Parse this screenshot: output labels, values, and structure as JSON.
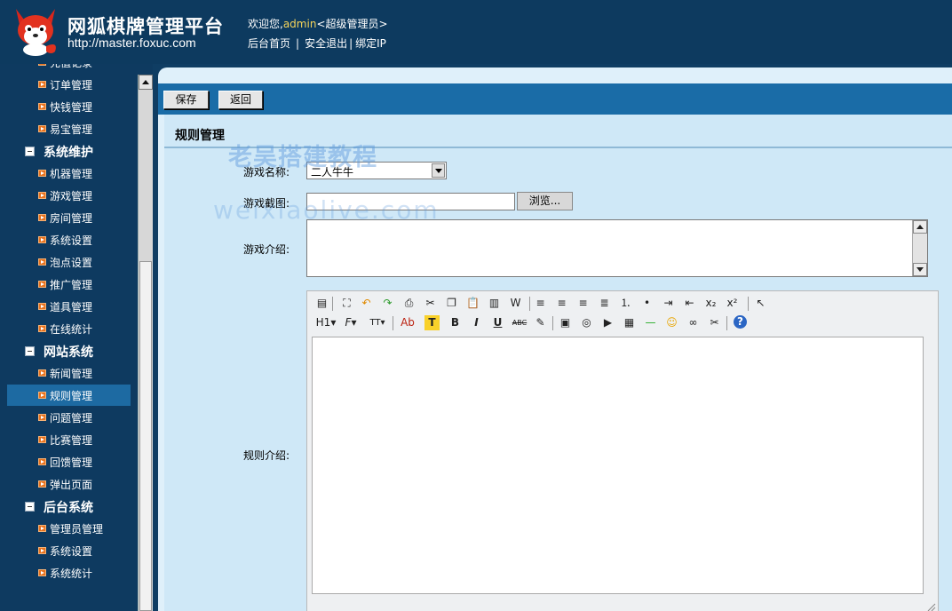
{
  "header": {
    "title": "网狐棋牌管理平台",
    "url": "http://master.foxuc.com",
    "welcome_prefix": "欢迎您,",
    "username": "admin",
    "role": "<超级管理员>",
    "links": [
      "后台首页",
      "安全退出",
      "绑定IP"
    ]
  },
  "sidebar": {
    "items": [
      {
        "type": "item",
        "label": "充值记录"
      },
      {
        "type": "item",
        "label": "订单管理"
      },
      {
        "type": "item",
        "label": "快钱管理"
      },
      {
        "type": "item",
        "label": "易宝管理"
      },
      {
        "type": "group",
        "label": "系统维护"
      },
      {
        "type": "item",
        "label": "机器管理"
      },
      {
        "type": "item",
        "label": "游戏管理"
      },
      {
        "type": "item",
        "label": "房间管理"
      },
      {
        "type": "item",
        "label": "系统设置"
      },
      {
        "type": "item",
        "label": "泡点设置"
      },
      {
        "type": "item",
        "label": "推广管理"
      },
      {
        "type": "item",
        "label": "道具管理"
      },
      {
        "type": "item",
        "label": "在线统计"
      },
      {
        "type": "group",
        "label": "网站系统"
      },
      {
        "type": "item",
        "label": "新闻管理"
      },
      {
        "type": "item",
        "label": "规则管理",
        "active": true
      },
      {
        "type": "item",
        "label": "问题管理"
      },
      {
        "type": "item",
        "label": "比赛管理"
      },
      {
        "type": "item",
        "label": "回馈管理"
      },
      {
        "type": "item",
        "label": "弹出页面"
      },
      {
        "type": "group",
        "label": "后台系统"
      },
      {
        "type": "item",
        "label": "管理员管理"
      },
      {
        "type": "item",
        "label": "系统设置"
      },
      {
        "type": "item",
        "label": "系统统计"
      }
    ]
  },
  "toolbar": {
    "save_label": "保存",
    "back_label": "返回"
  },
  "form": {
    "section_title": "规则管理",
    "game_name_label": "游戏名称:",
    "game_name_value": "二人牛牛",
    "screenshot_label": "游戏截图:",
    "browse_label": "浏览...",
    "intro_label": "游戏介绍:",
    "rules_label": "规则介绍:"
  },
  "editor": {
    "row1": [
      "source-icon",
      "fullscreen-icon",
      "undo-icon",
      "redo-icon",
      "print-icon",
      "cut-icon",
      "copy-icon",
      "paste-icon",
      "paste-text-icon",
      "paste-word-icon",
      "align-left-icon",
      "align-center-icon",
      "align-right-icon",
      "justify-icon",
      "ordered-list-icon",
      "unordered-list-icon",
      "indent-icon",
      "outdent-icon",
      "subscript-icon",
      "superscript-icon",
      "select-all-icon"
    ],
    "row2_labels": {
      "heading": "H1",
      "font": "F",
      "size": "TT",
      "fore": "Ab",
      "back": "T",
      "bold": "B",
      "italic": "I",
      "underline": "U",
      "strike": "ABC"
    }
  },
  "watermark": {
    "line1": "老吴搭建教程",
    "line2": "weixiaolive.com"
  },
  "colors": {
    "header_bg": "#0d3a5f",
    "accent": "#1a6ca7",
    "content_bg": "#cfe8f7",
    "bullet": "#e8721d"
  }
}
